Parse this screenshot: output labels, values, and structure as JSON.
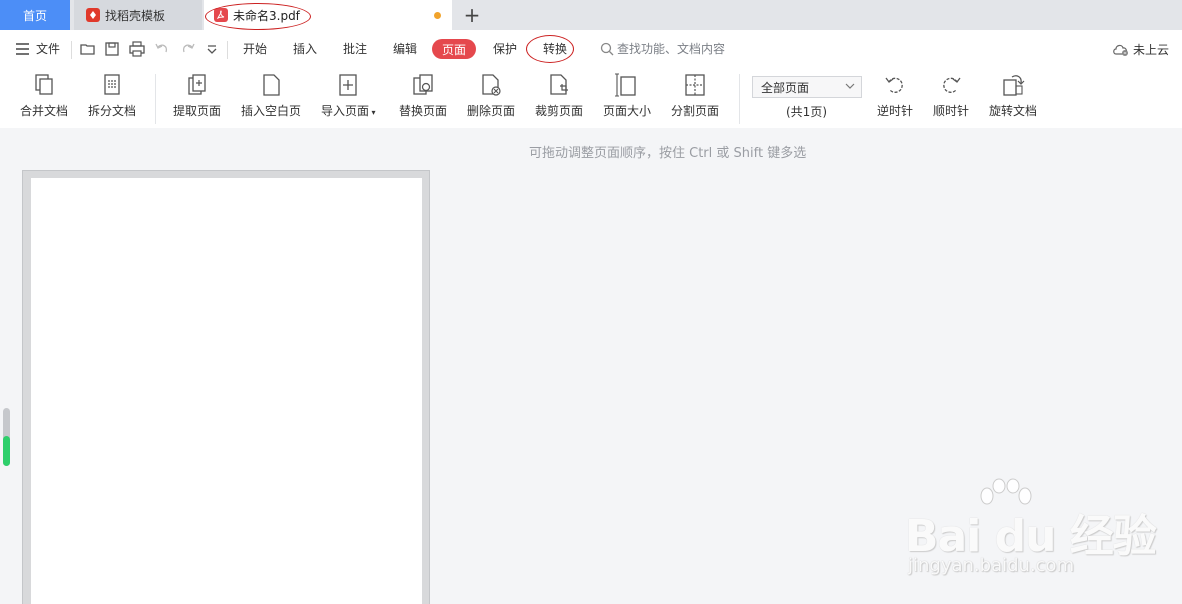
{
  "tabs": {
    "home": "首页",
    "template": "找稻壳模板",
    "active_doc": "未命名3.pdf",
    "new_tab": "+"
  },
  "menu": {
    "file": "文件",
    "items": [
      "开始",
      "插入",
      "批注",
      "编辑",
      "页面",
      "保护",
      "转换"
    ],
    "active_item": "页面",
    "search_placeholder": "查找功能、文档内容",
    "cloud_status": "未上云"
  },
  "ribbon": {
    "buttons": [
      "合并文档",
      "拆分文档",
      "提取页面",
      "插入空白页",
      "导入页面",
      "替换页面",
      "删除页面",
      "裁剪页面",
      "页面大小",
      "分割页面"
    ],
    "page_range_select": "全部页面",
    "page_count": "(共1页)",
    "rotate_buttons": [
      "逆时针",
      "顺时针",
      "旋转文档"
    ]
  },
  "content": {
    "drag_hint": "可拖动调整页面顺序，按住 Ctrl 或 Shift 键多选"
  },
  "watermark": {
    "logo": "Bai du 经验",
    "url": "jingyan.baidu.com"
  },
  "colors": {
    "accent_blue": "#4c8ef7",
    "accent_red": "#e5484d",
    "annotation_red": "#cc2222",
    "scroll_green": "#2ecf6b"
  }
}
